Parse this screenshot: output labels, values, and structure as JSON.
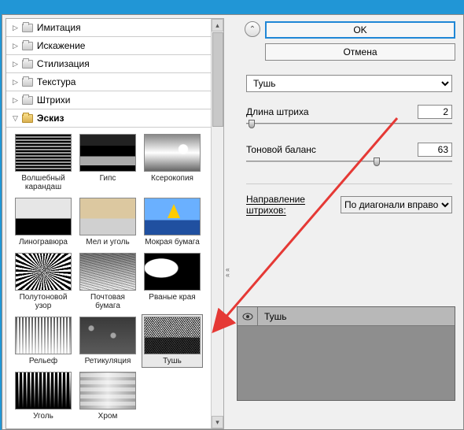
{
  "tree": {
    "groups": [
      {
        "label": "Имитация"
      },
      {
        "label": "Искажение"
      },
      {
        "label": "Стилизация"
      },
      {
        "label": "Текстура"
      },
      {
        "label": "Штрихи"
      }
    ],
    "expanded": {
      "label": "Эскиз"
    }
  },
  "thumbs": [
    {
      "label": "Волшебный карандаш"
    },
    {
      "label": "Гипс"
    },
    {
      "label": "Ксерокопия"
    },
    {
      "label": "Линогравюра"
    },
    {
      "label": "Мел и уголь"
    },
    {
      "label": "Мокрая бумага"
    },
    {
      "label": "Полутоновой узор"
    },
    {
      "label": "Почтовая бумага"
    },
    {
      "label": "Рваные края"
    },
    {
      "label": "Рельеф"
    },
    {
      "label": "Ретикуляция"
    },
    {
      "label": "Тушь"
    },
    {
      "label": "Уголь"
    },
    {
      "label": "Хром"
    }
  ],
  "buttons": {
    "ok": "OK",
    "cancel": "Отмена"
  },
  "params": {
    "filter_name": "Тушь",
    "stroke_len_label": "Длина штриха",
    "stroke_len_value": "2",
    "tonal_label": "Тоновой баланс",
    "tonal_value": "63",
    "direction_label": "Направление штрихов:",
    "direction_value": "По диагонали вправо"
  },
  "layer": {
    "name": "Тушь"
  }
}
